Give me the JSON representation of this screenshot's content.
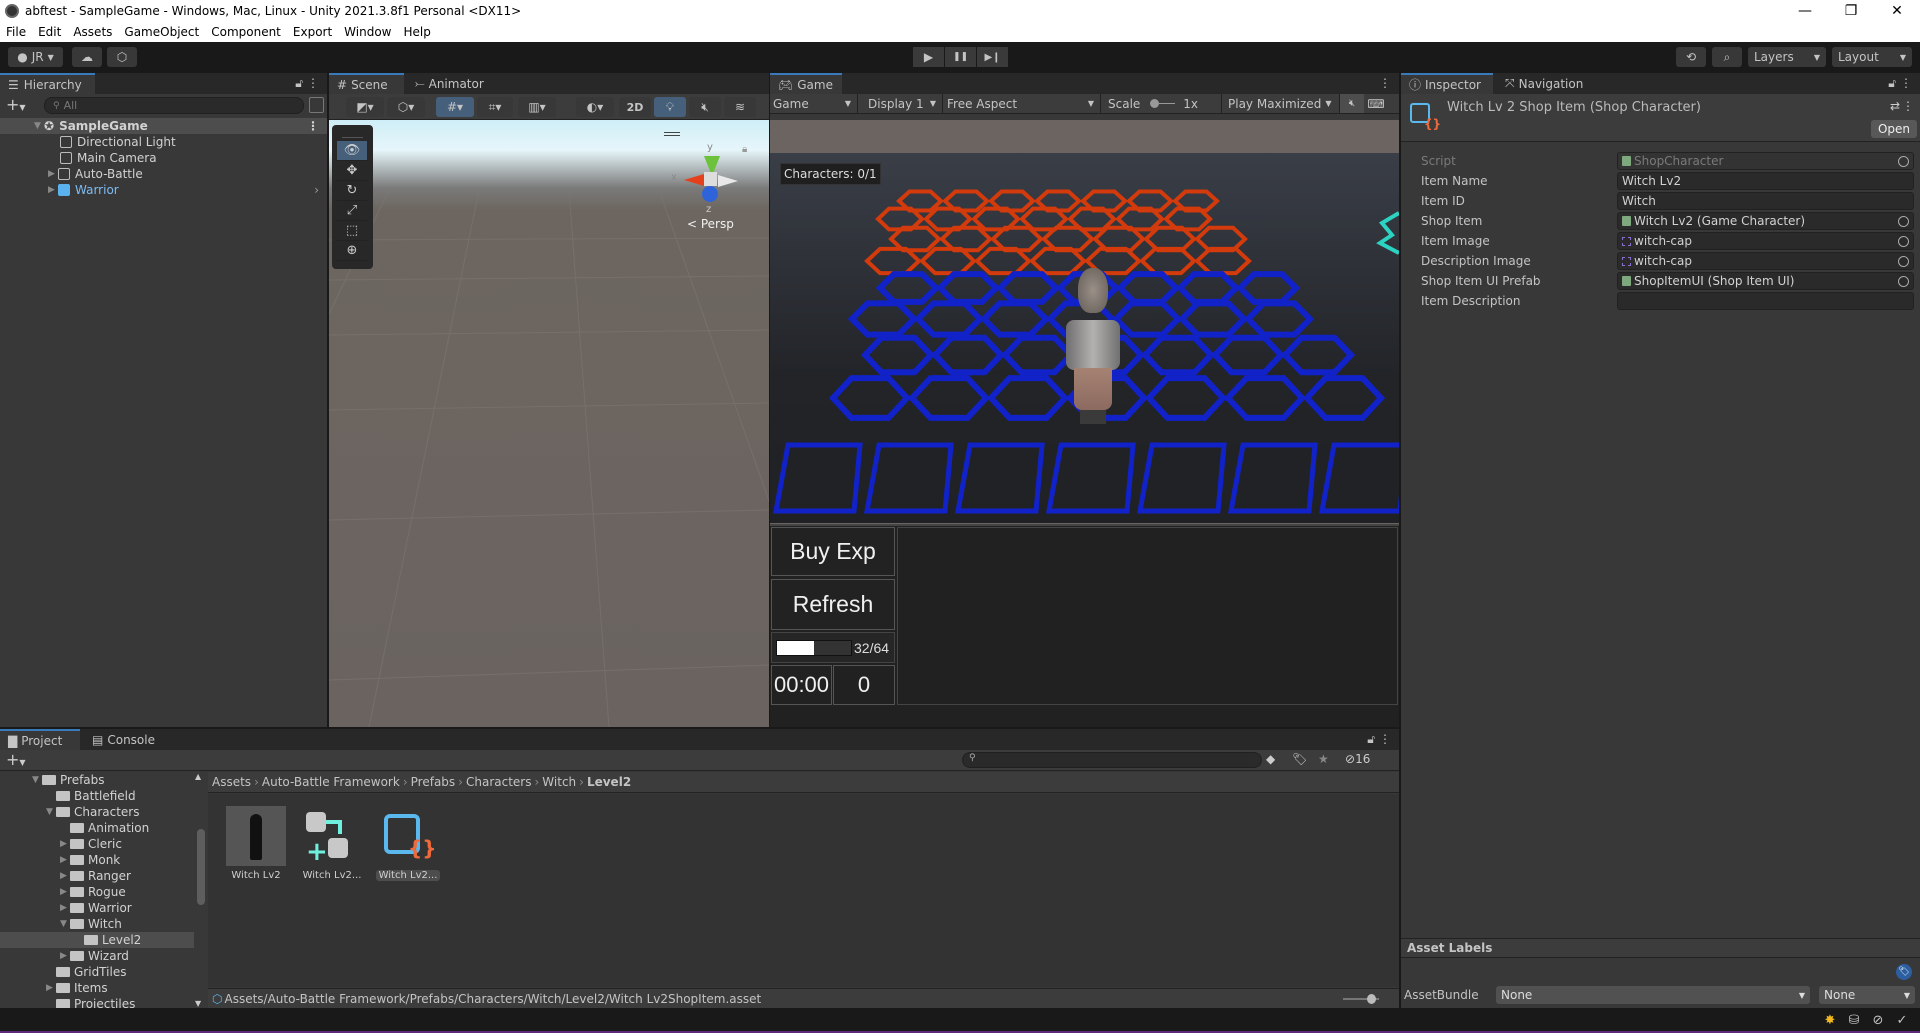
{
  "window": {
    "title": "abftest - SampleGame - Windows, Mac, Linux - Unity 2021.3.8f1 Personal <DX11>",
    "controls": {
      "minimize": "—",
      "maximize": "❐",
      "close": "✕"
    }
  },
  "menu": [
    "File",
    "Edit",
    "Assets",
    "GameObject",
    "Component",
    "Export",
    "Window",
    "Help"
  ],
  "toolbar": {
    "account": "JR",
    "layers": "Layers",
    "layout": "Layout",
    "play_icons": {
      "play": "▶",
      "pause": "❚❚",
      "step": "▶❙"
    }
  },
  "hierarchy": {
    "tab": "Hierarchy",
    "search_placeholder": "All",
    "scene": "SampleGame",
    "items": [
      {
        "label": "Directional Light",
        "expandable": false,
        "prefab": false
      },
      {
        "label": "Main Camera",
        "expandable": false,
        "prefab": false
      },
      {
        "label": "Auto-Battle",
        "expandable": true,
        "prefab": false
      },
      {
        "label": "Warrior",
        "expandable": true,
        "prefab": true
      }
    ]
  },
  "scene": {
    "tabs": [
      "Scene",
      "Animator"
    ],
    "toggle_2d": "2D",
    "persp_label": "< Persp",
    "axis_labels": {
      "x": "x",
      "y": "y",
      "z": "z"
    }
  },
  "game": {
    "tab": "Game",
    "mode": "Game",
    "display": "Display 1",
    "aspect": "Free Aspect",
    "scale_label": "Scale",
    "scale_value": "1x",
    "play_mode": "Play Maximized",
    "characters_label": "Characters: 0/1",
    "buy_exp": "Buy Exp",
    "refresh": "Refresh",
    "exp_text": "32/64",
    "exp_progress": 0.5,
    "timer": "00:00",
    "gold": "0",
    "colors": {
      "enemy_tiles": "#d33a0c",
      "player_tiles": "#1122c8",
      "bench_tiles": "#1122c8"
    }
  },
  "inspector": {
    "tabs": [
      "Inspector",
      "Navigation"
    ],
    "title": "Witch Lv 2 Shop Item (Shop Character)",
    "open_button": "Open",
    "fields": [
      {
        "label": "Script",
        "value": "ShopCharacter",
        "kind": "script",
        "picker": true,
        "disabled": true
      },
      {
        "label": "Item Name",
        "value": "Witch Lv2",
        "kind": "text",
        "picker": false
      },
      {
        "label": "Item ID",
        "value": "Witch",
        "kind": "text",
        "picker": false
      },
      {
        "label": "Shop Item",
        "value": "Witch Lv2 (Game Character)",
        "kind": "script",
        "picker": true
      },
      {
        "label": "Item Image",
        "value": "witch-cap",
        "kind": "sprite",
        "picker": true
      },
      {
        "label": "Description Image",
        "value": "witch-cap",
        "kind": "sprite",
        "picker": true
      },
      {
        "label": "Shop Item UI Prefab",
        "value": "ShopItemUI (Shop Item UI)",
        "kind": "script",
        "picker": true
      },
      {
        "label": "Item Description",
        "value": "",
        "kind": "text",
        "picker": false
      }
    ],
    "asset_labels": "Asset Labels",
    "asset_bundle_label": "AssetBundle",
    "asset_bundle_value": "None",
    "asset_bundle_variant": "None"
  },
  "project": {
    "tabs": [
      "Project",
      "Console"
    ],
    "hidden_count": "16",
    "tree": [
      {
        "label": "Prefabs",
        "depth": 0,
        "state": "open"
      },
      {
        "label": "Battlefield",
        "depth": 1,
        "state": "none"
      },
      {
        "label": "Characters",
        "depth": 1,
        "state": "open"
      },
      {
        "label": "Animation",
        "depth": 2,
        "state": "none"
      },
      {
        "label": "Cleric",
        "depth": 2,
        "state": "closed"
      },
      {
        "label": "Monk",
        "depth": 2,
        "state": "closed"
      },
      {
        "label": "Ranger",
        "depth": 2,
        "state": "closed"
      },
      {
        "label": "Rogue",
        "depth": 2,
        "state": "closed"
      },
      {
        "label": "Warrior",
        "depth": 2,
        "state": "closed"
      },
      {
        "label": "Witch",
        "depth": 2,
        "state": "open"
      },
      {
        "label": "Level2",
        "depth": 3,
        "state": "none",
        "selected": true
      },
      {
        "label": "Wizard",
        "depth": 2,
        "state": "closed"
      },
      {
        "label": "GridTiles",
        "depth": 1,
        "state": "none"
      },
      {
        "label": "Items",
        "depth": 1,
        "state": "closed"
      },
      {
        "label": "Projectiles",
        "depth": 1,
        "state": "none"
      }
    ],
    "breadcrumb": [
      "Assets",
      "Auto-Battle Framework",
      "Prefabs",
      "Characters",
      "Witch",
      "Level2"
    ],
    "assets": [
      {
        "label": "Witch Lv2",
        "type": "prefab"
      },
      {
        "label": "Witch Lv2...",
        "type": "variant"
      },
      {
        "label": "Witch Lv2...",
        "type": "scriptable",
        "selected": true
      }
    ],
    "path": "Assets/Auto-Battle Framework/Prefabs/Characters/Witch/Level2/Witch Lv2ShopItem.asset"
  }
}
